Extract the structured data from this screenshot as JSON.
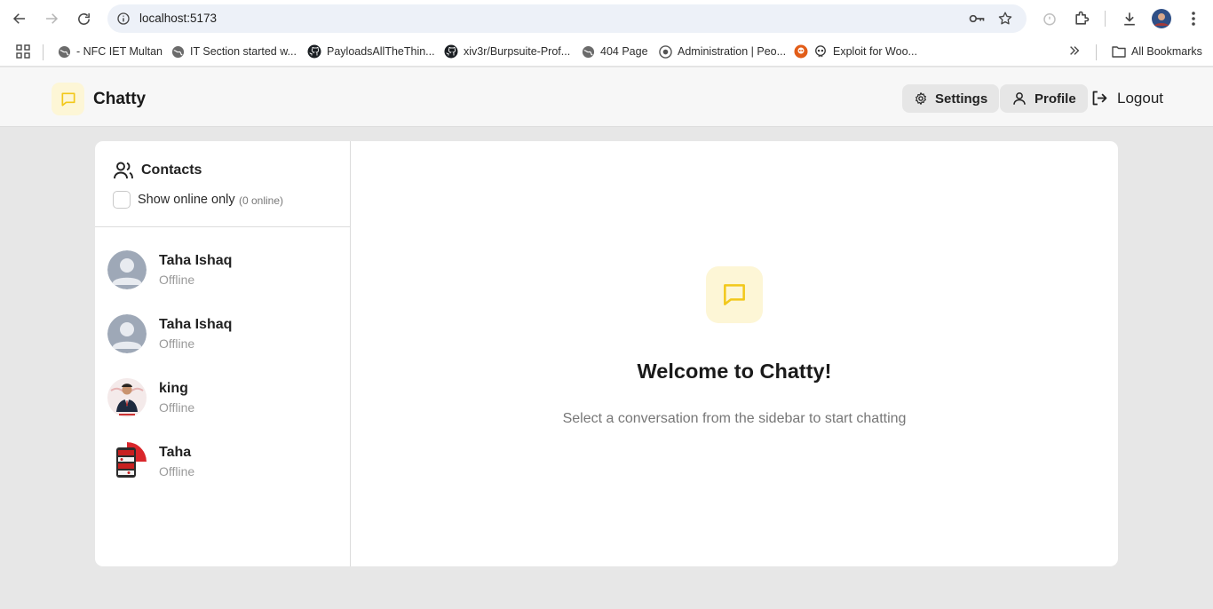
{
  "browser": {
    "url": "localhost:5173",
    "bookmarks": [
      {
        "label": "- NFC IET Multan",
        "icon": "globe-icon"
      },
      {
        "label": "IT Section started w...",
        "icon": "globe-icon"
      },
      {
        "label": "PayloadsAllTheThin...",
        "icon": "github-icon"
      },
      {
        "label": "xiv3r/Burpsuite-Prof...",
        "icon": "github-icon"
      },
      {
        "label": "404 Page",
        "icon": "globe-icon"
      },
      {
        "label": "Administration | Peo...",
        "icon": "gear-badge-icon"
      },
      {
        "label": "Exploit for Woo...",
        "icon": "skull-icon"
      }
    ],
    "all_bookmarks": "All Bookmarks"
  },
  "navbar": {
    "brand": "Chatty",
    "settings": "Settings",
    "profile": "Profile",
    "logout": "Logout"
  },
  "sidebar": {
    "title": "Contacts",
    "online_toggle": "Show online only",
    "online_count": "(0 online)",
    "contacts": [
      {
        "name": "Taha Ishaq",
        "status": "Offline",
        "avatar": "default-avatar-icon"
      },
      {
        "name": "Taha Ishaq",
        "status": "Offline",
        "avatar": "default-avatar-icon"
      },
      {
        "name": "king",
        "status": "Offline",
        "avatar": "photo-avatar"
      },
      {
        "name": "Taha",
        "status": "Offline",
        "avatar": "photo-avatar"
      }
    ]
  },
  "welcome": {
    "title": "Welcome to Chatty!",
    "subtitle": "Select a conversation from the sidebar to start chatting"
  },
  "colors": {
    "accent": "#f2c81b",
    "accent_bg": "#fdf6d6",
    "page_bg": "#e7e7e7"
  }
}
